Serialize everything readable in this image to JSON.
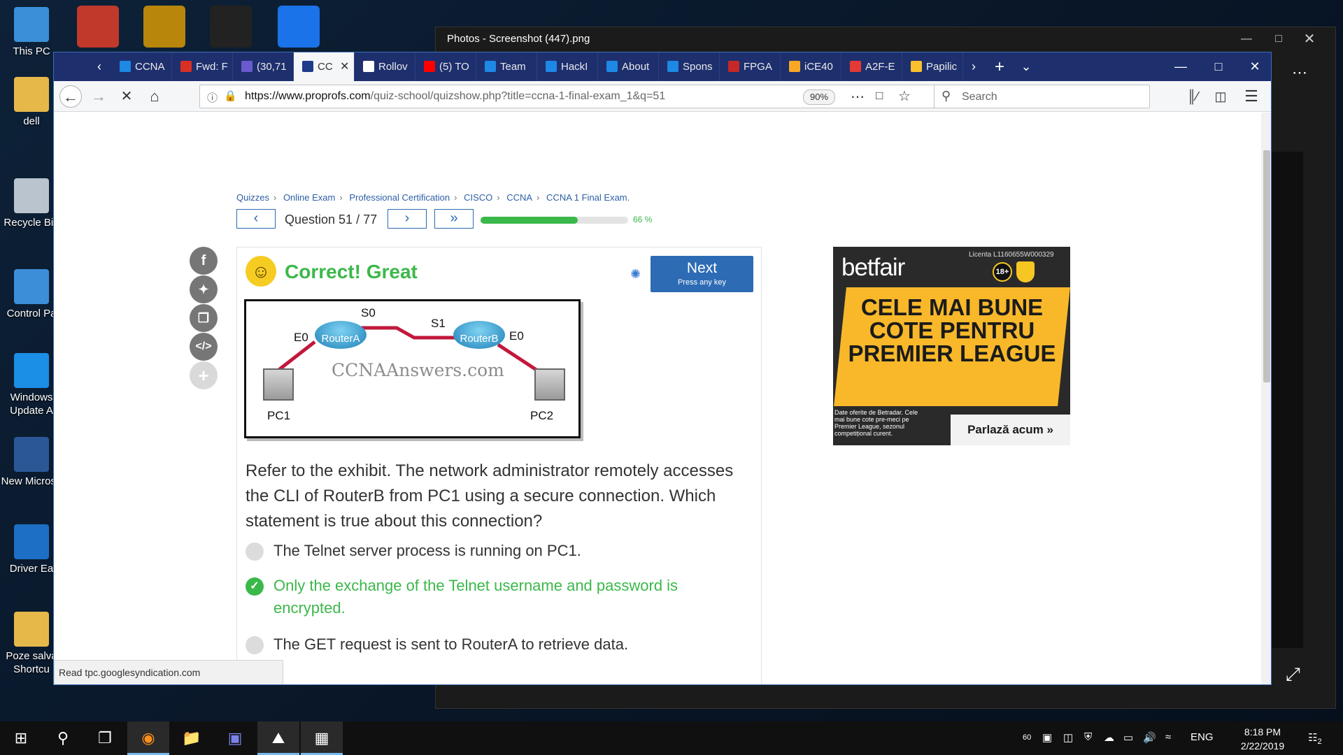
{
  "desktop": {
    "icons": [
      {
        "label": "This PC",
        "color": "#3a8fd8"
      },
      {
        "label": "dell",
        "color": "#e6b84a"
      },
      {
        "label": "Recycle Bin",
        "color": "#b9c4cf"
      },
      {
        "label": "Control Pa",
        "color": "#3c8ed9"
      },
      {
        "label": "Windows Update A",
        "color": "#1b8ee6"
      },
      {
        "label": "New Microso",
        "color": "#2b5797"
      },
      {
        "label": "Driver Ea",
        "color": "#1c6fc4"
      },
      {
        "label": "Poze salva Shortcu",
        "color": "#e6b84a"
      }
    ]
  },
  "photos": {
    "title": "Photos - Screenshot (447).png",
    "more_icon": "ellipsis-icon",
    "expand_icon": "expand-icon"
  },
  "browser": {
    "tabs": [
      {
        "label": "CCNA",
        "color": "#1e88e5"
      },
      {
        "label": "Fwd: F",
        "color": "#d93025"
      },
      {
        "label": "(30,71",
        "color": "#6a5acd"
      },
      {
        "label": "CC",
        "color": "#1e3a8a",
        "active": true
      },
      {
        "label": "Rollov",
        "color": "#ffffff"
      },
      {
        "label": "(5) TO",
        "color": "#ff0000"
      },
      {
        "label": "Team",
        "color": "#1e88e5"
      },
      {
        "label": "HackI",
        "color": "#1e88e5"
      },
      {
        "label": "About",
        "color": "#1e88e5"
      },
      {
        "label": "Spons",
        "color": "#1e88e5"
      },
      {
        "label": "FPGA",
        "color": "#c62828"
      },
      {
        "label": "iCE40",
        "color": "#f9a825"
      },
      {
        "label": "A2F-E",
        "color": "#e53935"
      },
      {
        "label": "Papilic",
        "color": "#fbc02d"
      }
    ],
    "url_domain": "https://www.proprofs.com",
    "url_path": "/quiz-school/quizshow.php?title=ccna-1-final-exam_1&q=51",
    "zoom": "90%",
    "search_placeholder": "Search",
    "status_text": "Read tpc.googlesyndication.com"
  },
  "quiz": {
    "breadcrumb": [
      "Quizzes",
      "Online Exam",
      "Professional Certification",
      "CISCO",
      "CCNA",
      "CCNA 1 Final Exam."
    ],
    "question_counter": "Question 51 / 77",
    "progress_label": "66 %",
    "progress_value": 0.66,
    "result": "Correct! Great",
    "next_label": "Next",
    "next_sub": "Press any key",
    "exhibit": {
      "s0": "S0",
      "s1": "S1",
      "e0_left": "E0",
      "e0_right": "E0",
      "router_a": "RouterA",
      "router_b": "RouterB",
      "pc1": "PC1",
      "pc2": "PC2",
      "watermark": "CCNAAnswers.com"
    },
    "question": "Refer to the exhibit. The network administrator remotely accesses the CLI of RouterB from PC1 using a secure connection. Which statement is true about this connection?",
    "options": [
      {
        "text": "The Telnet server process is running on PC1.",
        "correct": false
      },
      {
        "text": "Only the exchange of the Telnet username and password is encrypted.",
        "correct": true
      },
      {
        "text": "The GET request is sent to RouterA to retrieve data.",
        "correct": false
      }
    ]
  },
  "ad": {
    "brand": "betfair",
    "license": "Licenta L1160655W000329",
    "age": "18+",
    "headline": "CELE MAI BUNE COTE PENTRU PREMIER LEAGUE",
    "small_print": "Date oferite de Betradar. Cele mai bune cote pre-meci pe Premier League, sezonul competițional curent.",
    "cta": "Parlază acum",
    "accent": "#f8b82a"
  },
  "taskbar": {
    "time": "8:18 PM",
    "date": "2/22/2019",
    "language": "ENG",
    "battery": "60",
    "notifications": "2"
  }
}
